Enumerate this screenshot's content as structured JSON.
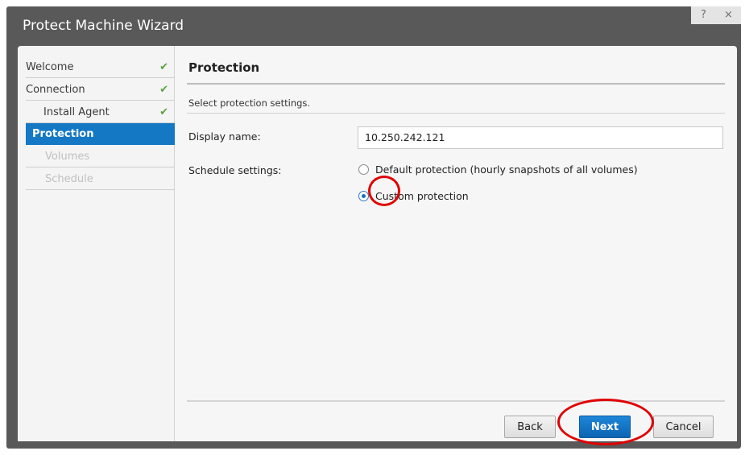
{
  "window": {
    "title": "Protect Machine Wizard",
    "help_label": "?",
    "close_label": "×"
  },
  "sidebar": {
    "items": [
      {
        "label": "Welcome",
        "state": "done"
      },
      {
        "label": "Connection",
        "state": "done"
      },
      {
        "label": "Install Agent",
        "state": "done"
      },
      {
        "label": "Protection",
        "state": "active"
      },
      {
        "label": "Volumes",
        "state": "disabled"
      },
      {
        "label": "Schedule",
        "state": "disabled"
      }
    ],
    "check_glyph": "✔"
  },
  "main": {
    "heading": "Protection",
    "subtitle": "Select protection settings.",
    "display_name_label": "Display name:",
    "display_name_value": "10.250.242.121",
    "schedule_label": "Schedule settings:",
    "options": [
      {
        "label": "Default protection (hourly snapshots of all volumes)",
        "selected": false
      },
      {
        "label": "Custom protection",
        "selected": true
      }
    ]
  },
  "buttons": {
    "back": "Back",
    "next": "Next",
    "cancel": "Cancel"
  },
  "colors": {
    "accent": "#1478c5",
    "check": "#56a33c",
    "annotation": "#e00000",
    "titlebar": "#595959"
  },
  "icons": [
    "help-icon",
    "close-icon",
    "check-icon",
    "radio-icon"
  ]
}
